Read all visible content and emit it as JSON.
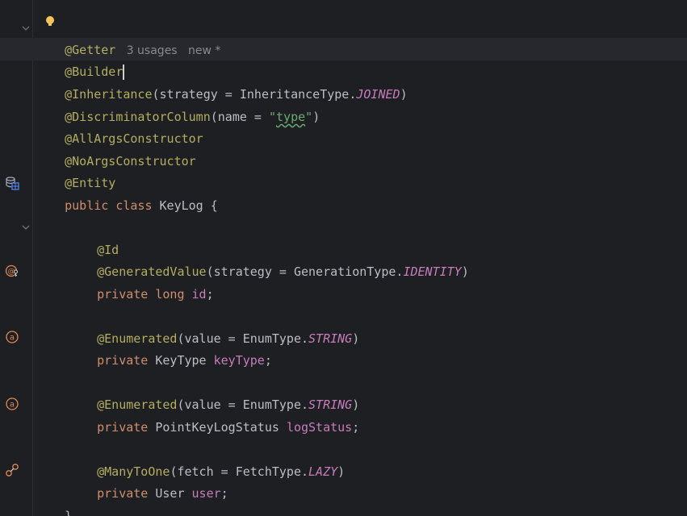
{
  "editor": {
    "hint_usages": "3 usages",
    "hint_new": "new *",
    "lines": {
      "getter": "@Getter",
      "builder": "@Builder",
      "inheritance_ann": "@Inheritance",
      "inheritance_open": "(strategy = InheritanceType.",
      "inheritance_const": "JOINED",
      "inheritance_close": ")",
      "discriminator_ann": "@DiscriminatorColumn",
      "discriminator_open": "(name = ",
      "discriminator_q1": "\"",
      "discriminator_str": "type",
      "discriminator_q2": "\"",
      "discriminator_close": ")",
      "allargs": "@AllArgsConstructor",
      "noargs": "@NoArgsConstructor",
      "entity": "@Entity",
      "class_kw": "public class ",
      "class_name": "KeyLog {",
      "id_ann": "@Id",
      "genval_ann": "@GeneratedValue",
      "genval_open": "(strategy = GenerationType.",
      "genval_const": "IDENTITY",
      "genval_close": ")",
      "id_kw": "private long ",
      "id_field": "id",
      "id_semi": ";",
      "enum1_ann": "@Enumerated",
      "enum1_open": "(value = EnumType.",
      "enum1_const": "STRING",
      "enum1_close": ")",
      "keytype_kw": "private ",
      "keytype_type": "KeyType ",
      "keytype_field": "keyType",
      "keytype_semi": ";",
      "enum2_ann": "@Enumerated",
      "enum2_open": "(value = EnumType.",
      "enum2_const": "STRING",
      "enum2_close": ")",
      "status_kw": "private ",
      "status_type": "PointKeyLogStatus ",
      "status_field": "logStatus",
      "status_semi": ";",
      "manytoone_ann": "@ManyToOne",
      "manytoone_open": "(fetch = FetchType.",
      "manytoone_const": "LAZY",
      "manytoone_close": ")",
      "user_kw": "private ",
      "user_type": "User ",
      "user_field": "user",
      "user_semi": ";",
      "closing_brace": "}"
    }
  },
  "colors": {
    "background": "#1e1f22",
    "annotation": "#b3ae60",
    "keyword": "#cf8e6d",
    "field": "#c77dbb",
    "string": "#6aab73",
    "text": "#bcbec4"
  }
}
